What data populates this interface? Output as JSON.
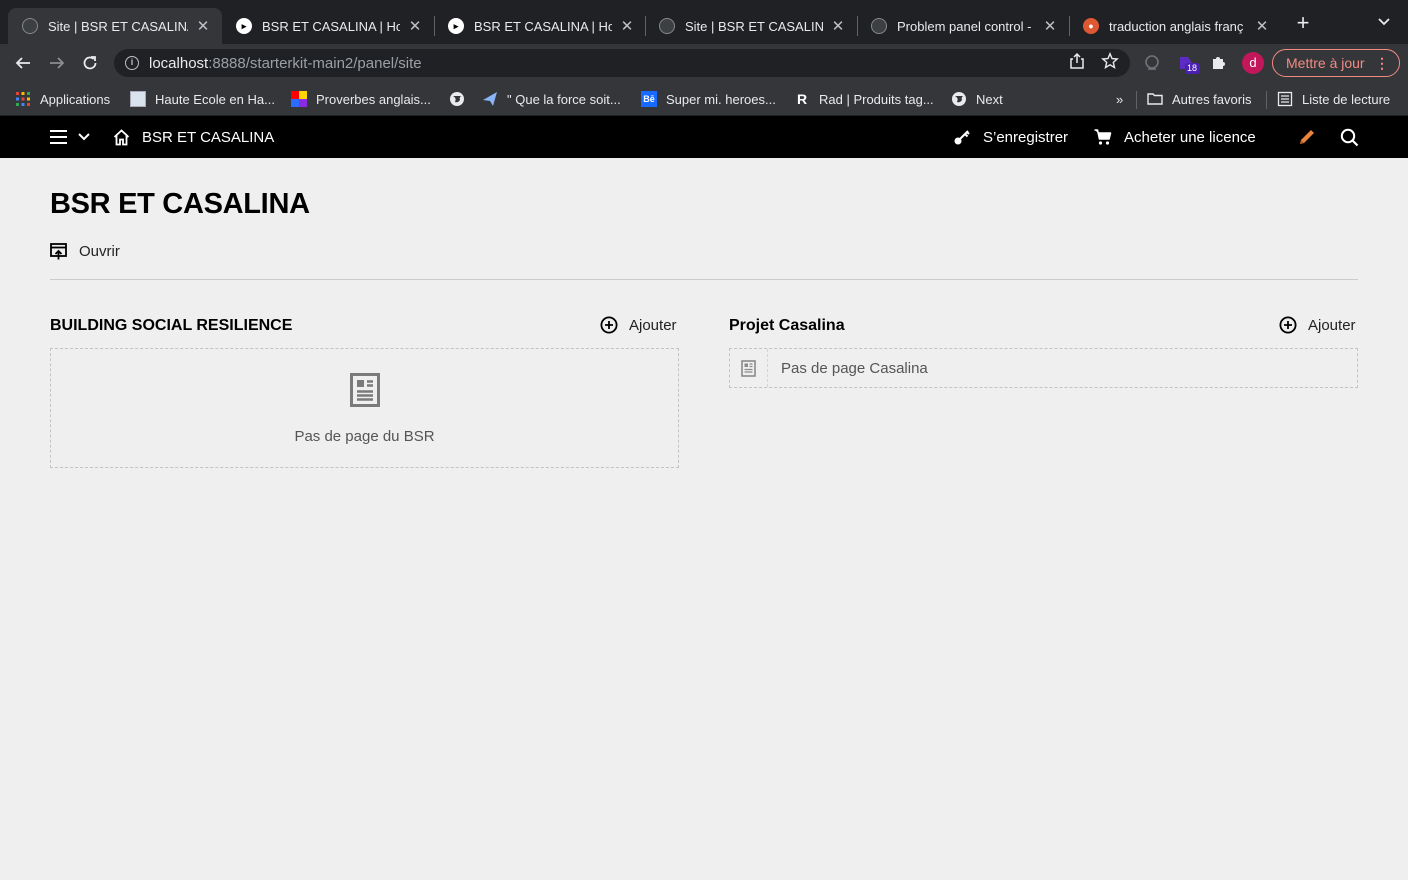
{
  "browser": {
    "tabs": [
      {
        "title": "Site | BSR ET CASALINA",
        "active": true,
        "favicon": "kirby-icon"
      },
      {
        "title": "BSR ET CASALINA | Hom",
        "active": false,
        "favicon": "kirby-icon"
      },
      {
        "title": "BSR ET CASALINA | Hom",
        "active": false,
        "favicon": "kirby-icon"
      },
      {
        "title": "Site | BSR ET CASALINA",
        "active": false,
        "favicon": "kirby-icon"
      },
      {
        "title": "Problem panel control -",
        "active": false,
        "favicon": "kirby-icon"
      },
      {
        "title": "traduction anglais franç",
        "active": false,
        "favicon": "duckduckgo-icon"
      }
    ],
    "address": {
      "host": "localhost",
      "path": ":8888/starterkit-main2/panel/site"
    },
    "extension_badge": "18",
    "profile_initial": "d",
    "update_label": "Mettre à jour",
    "bookmarks": [
      {
        "label": "Applications",
        "icon": "apps-grid-icon"
      },
      {
        "label": "Haute Ecole en Ha...",
        "icon": "school-icon"
      },
      {
        "label": "Proverbes anglais...",
        "icon": "colorful-squares-icon"
      },
      {
        "label": "",
        "icon": "globe-icon"
      },
      {
        "label": "\" Que la force soit...",
        "icon": "paper-plane-icon"
      },
      {
        "label": "Super mi. heroes...",
        "icon": "behance-icon"
      },
      {
        "label": "Rad | Produits tag...",
        "icon": "r-letter-icon"
      },
      {
        "label": "Next",
        "icon": "globe-icon"
      }
    ],
    "bookmarks_overflow": "»",
    "other_bookmarks": "Autres favoris",
    "reading_list": "Liste de lecture"
  },
  "panel": {
    "site_name": "BSR ET CASALINA",
    "register_label": "S’enregistrer",
    "license_label": "Acheter une licence"
  },
  "page": {
    "title": "BSR ET CASALINA",
    "open_label": "Ouvrir",
    "sections": [
      {
        "title": "BUILDING SOCIAL RESILIENCE",
        "add_label": "Ajouter",
        "empty_text": "Pas de page du BSR"
      },
      {
        "title": "Projet Casalina",
        "add_label": "Ajouter",
        "empty_text": "Pas de page Casalina"
      }
    ]
  },
  "colors": {
    "panel_bar": "#000000",
    "accent_pencil": "#e8843c",
    "update_border": "#f28b82"
  }
}
